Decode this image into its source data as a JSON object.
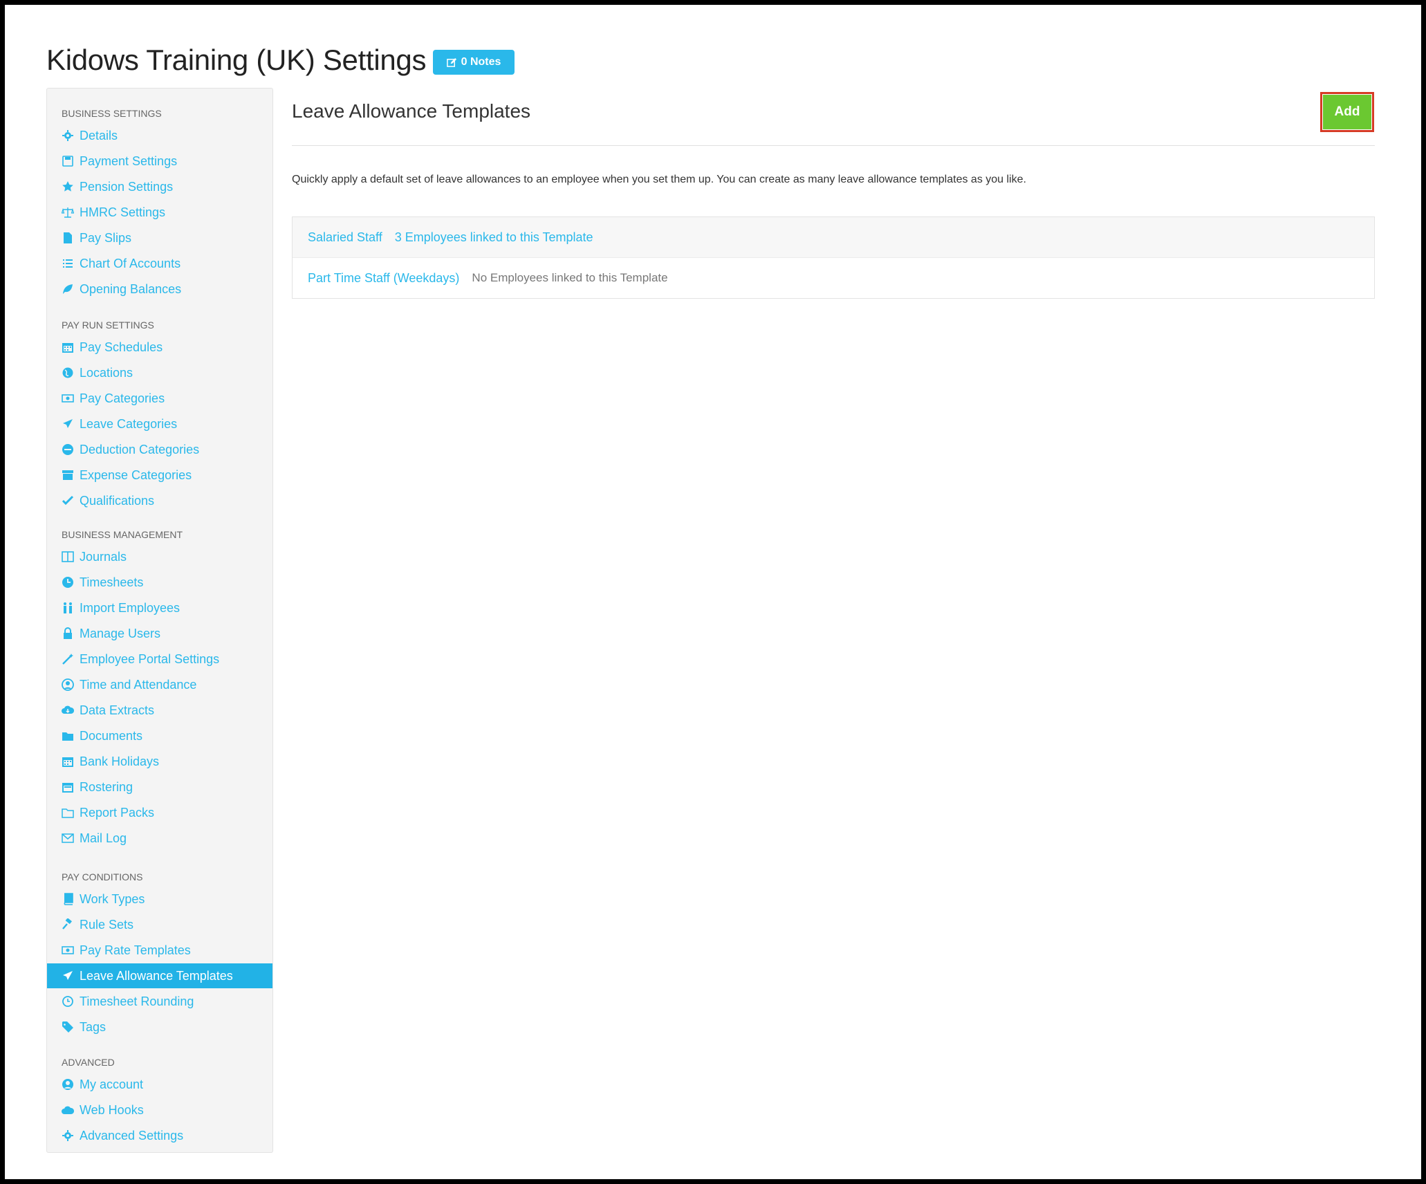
{
  "page": {
    "title": "Kidows Training (UK) Settings",
    "notes_label": "0 Notes"
  },
  "sidebar": {
    "sections": [
      {
        "heading": "BUSINESS SETTINGS",
        "items": [
          {
            "label": "Details",
            "icon": "gear-icon"
          },
          {
            "label": "Payment Settings",
            "icon": "floppy-icon"
          },
          {
            "label": "Pension Settings",
            "icon": "star-icon"
          },
          {
            "label": "HMRC Settings",
            "icon": "scales-icon"
          },
          {
            "label": "Pay Slips",
            "icon": "document-icon"
          },
          {
            "label": "Chart Of Accounts",
            "icon": "list-icon"
          },
          {
            "label": "Opening Balances",
            "icon": "leaf-icon"
          }
        ]
      },
      {
        "heading": "PAY RUN SETTINGS",
        "items": [
          {
            "label": "Pay Schedules",
            "icon": "calendar-icon"
          },
          {
            "label": "Locations",
            "icon": "globe-icon"
          },
          {
            "label": "Pay Categories",
            "icon": "money-icon"
          },
          {
            "label": "Leave Categories",
            "icon": "plane-icon"
          },
          {
            "label": "Deduction Categories",
            "icon": "minus-circle-icon"
          },
          {
            "label": "Expense Categories",
            "icon": "archive-icon"
          },
          {
            "label": "Qualifications",
            "icon": "check-icon"
          }
        ]
      },
      {
        "heading": "BUSINESS MANAGEMENT",
        "items": [
          {
            "label": "Journals",
            "icon": "columns-icon"
          },
          {
            "label": "Timesheets",
            "icon": "clock-icon"
          },
          {
            "label": "Import Employees",
            "icon": "users-icon"
          },
          {
            "label": "Manage Users",
            "icon": "lock-icon"
          },
          {
            "label": "Employee Portal Settings",
            "icon": "magic-wand-icon"
          },
          {
            "label": "Time and Attendance",
            "icon": "user-clock-icon"
          },
          {
            "label": "Data Extracts",
            "icon": "cloud-download-icon"
          },
          {
            "label": "Documents",
            "icon": "folder-icon"
          },
          {
            "label": "Bank Holidays",
            "icon": "calendar-icon"
          },
          {
            "label": "Rostering",
            "icon": "calendar-grid-icon"
          },
          {
            "label": "Report Packs",
            "icon": "folder-outline-icon"
          },
          {
            "label": "Mail Log",
            "icon": "envelope-icon"
          }
        ]
      },
      {
        "heading": "PAY CONDITIONS",
        "items": [
          {
            "label": "Work Types",
            "icon": "book-icon"
          },
          {
            "label": "Rule Sets",
            "icon": "gavel-icon"
          },
          {
            "label": "Pay Rate Templates",
            "icon": "money-icon"
          },
          {
            "label": "Leave Allowance Templates",
            "icon": "plane-icon",
            "active": true
          },
          {
            "label": "Timesheet Rounding",
            "icon": "clock-outline-icon"
          },
          {
            "label": "Tags",
            "icon": "tag-icon"
          }
        ]
      },
      {
        "heading": "ADVANCED",
        "items": [
          {
            "label": "My account",
            "icon": "user-circle-icon"
          },
          {
            "label": "Web Hooks",
            "icon": "cloud-icon"
          },
          {
            "label": "Advanced Settings",
            "icon": "gear-icon"
          }
        ]
      }
    ]
  },
  "main": {
    "title": "Leave Allowance Templates",
    "add_label": "Add",
    "description": "Quickly apply a default set of leave allowances to an employee when you set them up. You can create as many leave allowance templates as you like.",
    "templates": [
      {
        "name": "Salaried Staff",
        "status": "3 Employees linked to this Template",
        "linked": true
      },
      {
        "name": "Part Time Staff (Weekdays)",
        "status": "No Employees linked to this Template",
        "linked": false
      }
    ]
  },
  "colors": {
    "accent": "#2ab8ea",
    "active_bg": "#22b2e6",
    "add_button": "#6bc831",
    "highlight_border": "#d63b25"
  }
}
